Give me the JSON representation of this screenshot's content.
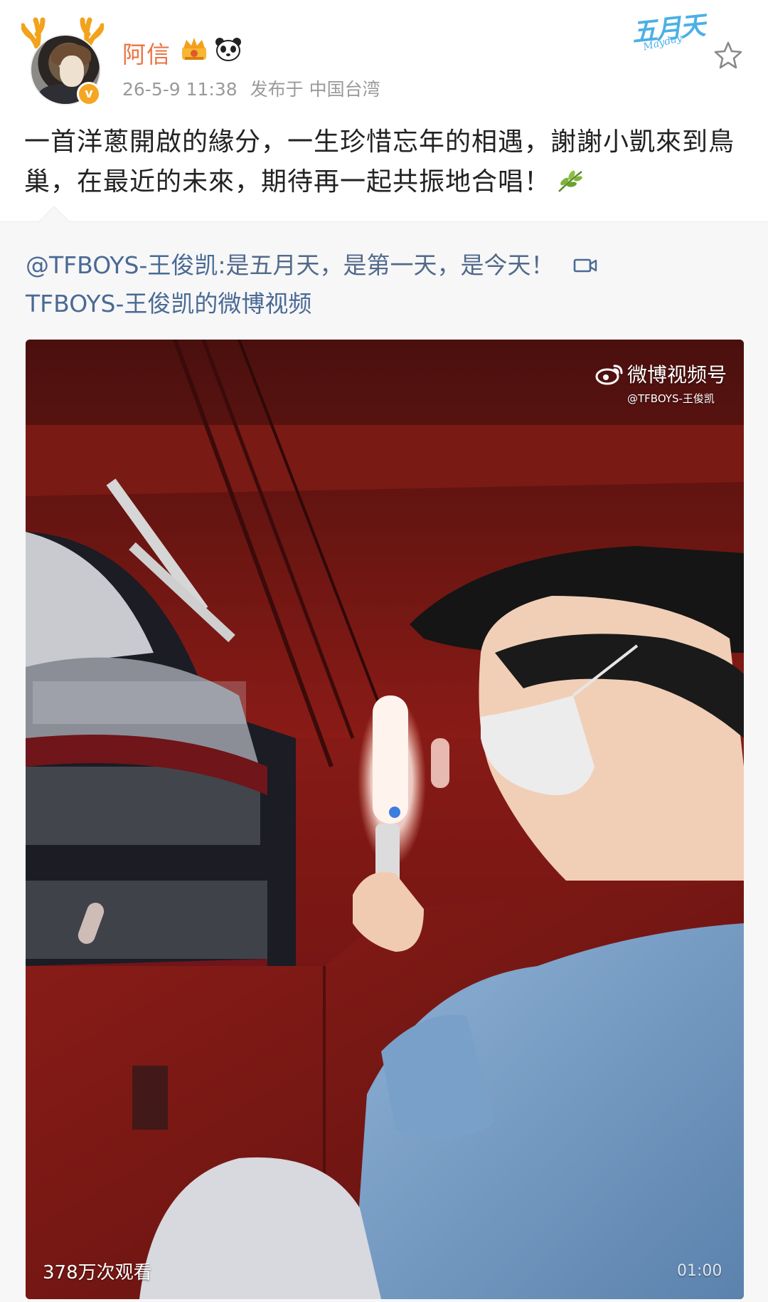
{
  "post": {
    "username": "阿信",
    "timestamp": "26-5-9 11:38",
    "location": "发布于 中国台湾",
    "text": "一首洋蔥開啟的緣分，一生珍惜忘年的相遇，謝謝小凱來到鳥巢，在最近的未來，期待再一起共振地合唱！",
    "verified_mark": "v",
    "logo_text": "五月天",
    "logo_sub": "Mayday"
  },
  "repost": {
    "mention": "@TFBOYS-王俊凯",
    "quote": ":是五月天，是第一天，是今天！",
    "video_title": "TFBOYS-王俊凯的微博视频"
  },
  "video": {
    "watermark": "微博视频号",
    "watermark_sub": "@TFBOYS-王俊凯",
    "views": "378万次观看",
    "duration": "01:00"
  },
  "icons": {
    "star": "favorite-star-icon",
    "leaf": "olive-branch-emoji-icon",
    "video_link": "video-link-icon",
    "weibo": "weibo-logo-icon"
  },
  "colors": {
    "username": "#eb7340",
    "link": "#4a6a95",
    "meta": "#9a9a9a",
    "verified": "#f5a623"
  }
}
